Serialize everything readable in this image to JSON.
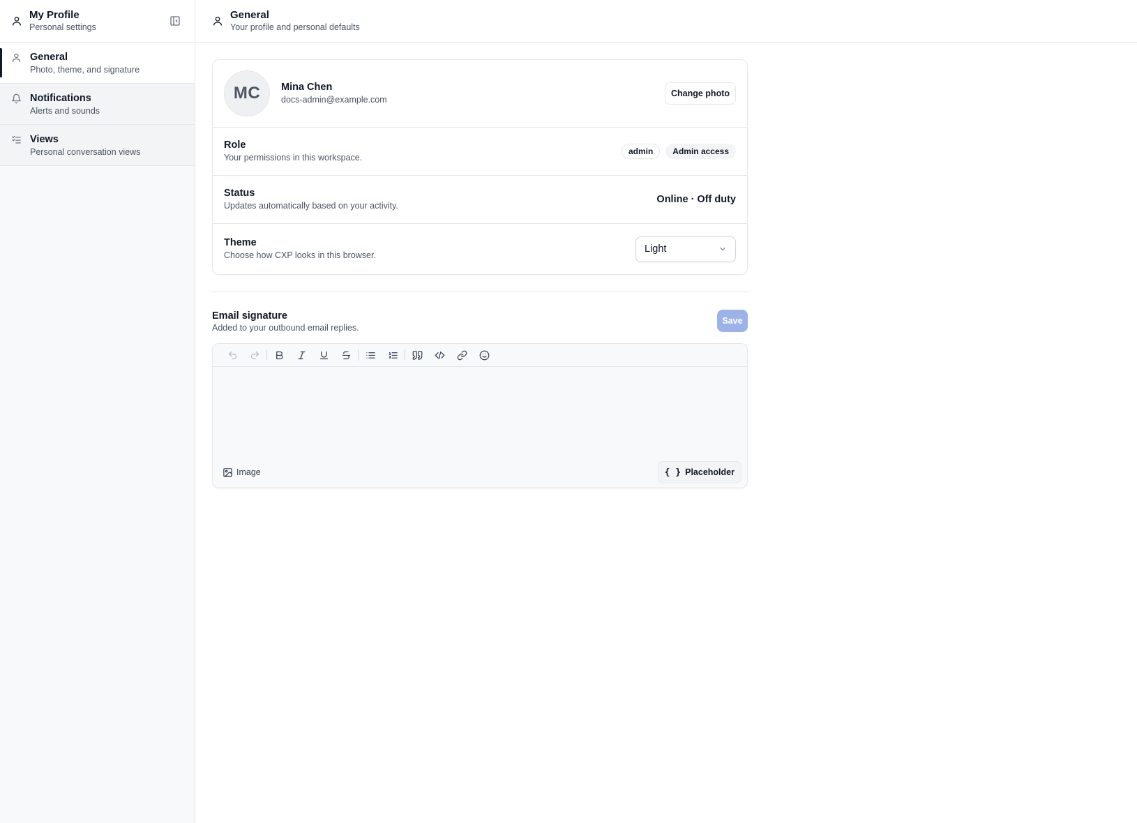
{
  "sidebar": {
    "title": "My Profile",
    "subtitle": "Personal settings",
    "items": [
      {
        "label": "General",
        "sub": "Photo, theme, and signature",
        "icon": "user-icon"
      },
      {
        "label": "Notifications",
        "sub": "Alerts and sounds",
        "icon": "bell-icon"
      },
      {
        "label": "Views",
        "sub": "Personal conversation views",
        "icon": "list-check-icon"
      }
    ]
  },
  "header": {
    "title": "General",
    "subtitle": "Your profile and personal defaults"
  },
  "profile": {
    "initials": "MC",
    "name": "Mina Chen",
    "email": "docs-admin@example.com",
    "change_photo": "Change photo"
  },
  "role": {
    "title": "Role",
    "desc": "Your permissions in this workspace.",
    "badges": [
      "admin",
      "Admin access"
    ]
  },
  "status": {
    "title": "Status",
    "desc": "Updates automatically based on your activity.",
    "value": "Online · Off duty"
  },
  "theme": {
    "title": "Theme",
    "desc": "Choose how CXP looks in this browser.",
    "selected": "Light"
  },
  "signature": {
    "title": "Email signature",
    "desc": "Added to your outbound email replies.",
    "save": "Save",
    "image_label": "Image",
    "placeholder_label": "Placeholder",
    "placeholder_glyph": "{ }"
  },
  "colors": {
    "accent_disabled": "#9db3e8",
    "active_indicator": "#111827"
  }
}
